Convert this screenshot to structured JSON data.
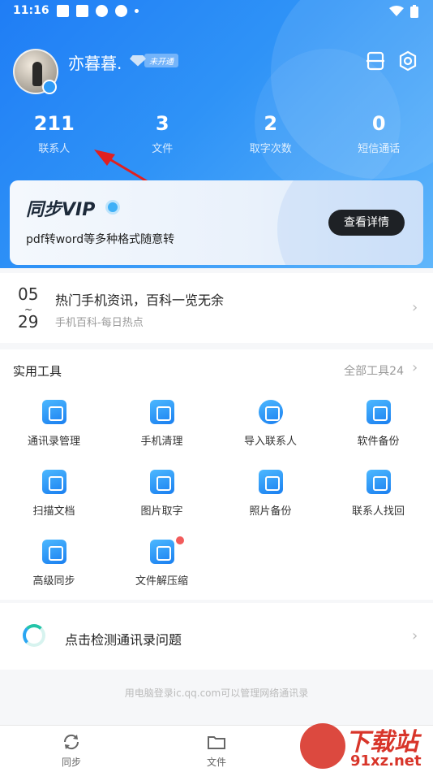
{
  "status_bar": {
    "time": "11:16"
  },
  "profile": {
    "username": "亦暮暮.",
    "vip_status": "未开通"
  },
  "stats": [
    {
      "value": "211",
      "label": "联系人"
    },
    {
      "value": "3",
      "label": "文件"
    },
    {
      "value": "2",
      "label": "取字次数"
    },
    {
      "value": "0",
      "label": "短信通话"
    }
  ],
  "vip_card": {
    "title": "同步VIP",
    "description": "pdf转word等多种格式随意转",
    "button": "查看详情"
  },
  "news": {
    "month": "05",
    "sep": "~",
    "day": "29",
    "title": "热门手机资讯，百科一览无余",
    "subtitle": "手机百科-每日热点"
  },
  "tools": {
    "header": "实用工具",
    "all_label": "全部工具24",
    "items": [
      {
        "label": "通讯录管理",
        "icon": "contacts-book-icon"
      },
      {
        "label": "手机清理",
        "icon": "phone-clean-icon"
      },
      {
        "label": "导入联系人",
        "icon": "import-contact-icon"
      },
      {
        "label": "软件备份",
        "icon": "app-backup-icon"
      },
      {
        "label": "扫描文档",
        "icon": "scan-document-icon"
      },
      {
        "label": "图片取字",
        "icon": "image-text-icon"
      },
      {
        "label": "照片备份",
        "icon": "photo-backup-icon"
      },
      {
        "label": "联系人找回",
        "icon": "contact-recover-icon"
      },
      {
        "label": "高级同步",
        "icon": "advanced-sync-icon"
      },
      {
        "label": "文件解压缩",
        "icon": "unzip-icon"
      }
    ]
  },
  "detect": {
    "label": "点击检测通讯录问题"
  },
  "footer_note": "用电脑登录ic.qq.com可以管理网络通讯录",
  "tabbar": [
    {
      "label": "同步",
      "icon": "sync-icon"
    },
    {
      "label": "文件",
      "icon": "folder-icon"
    }
  ],
  "watermark": {
    "big": "下载站",
    "small": "91xz.net"
  },
  "colors": {
    "hero_start": "#1f7df5",
    "hero_end": "#5fb6fb",
    "arrow": "#e02020",
    "accent": "#2f93f7"
  }
}
